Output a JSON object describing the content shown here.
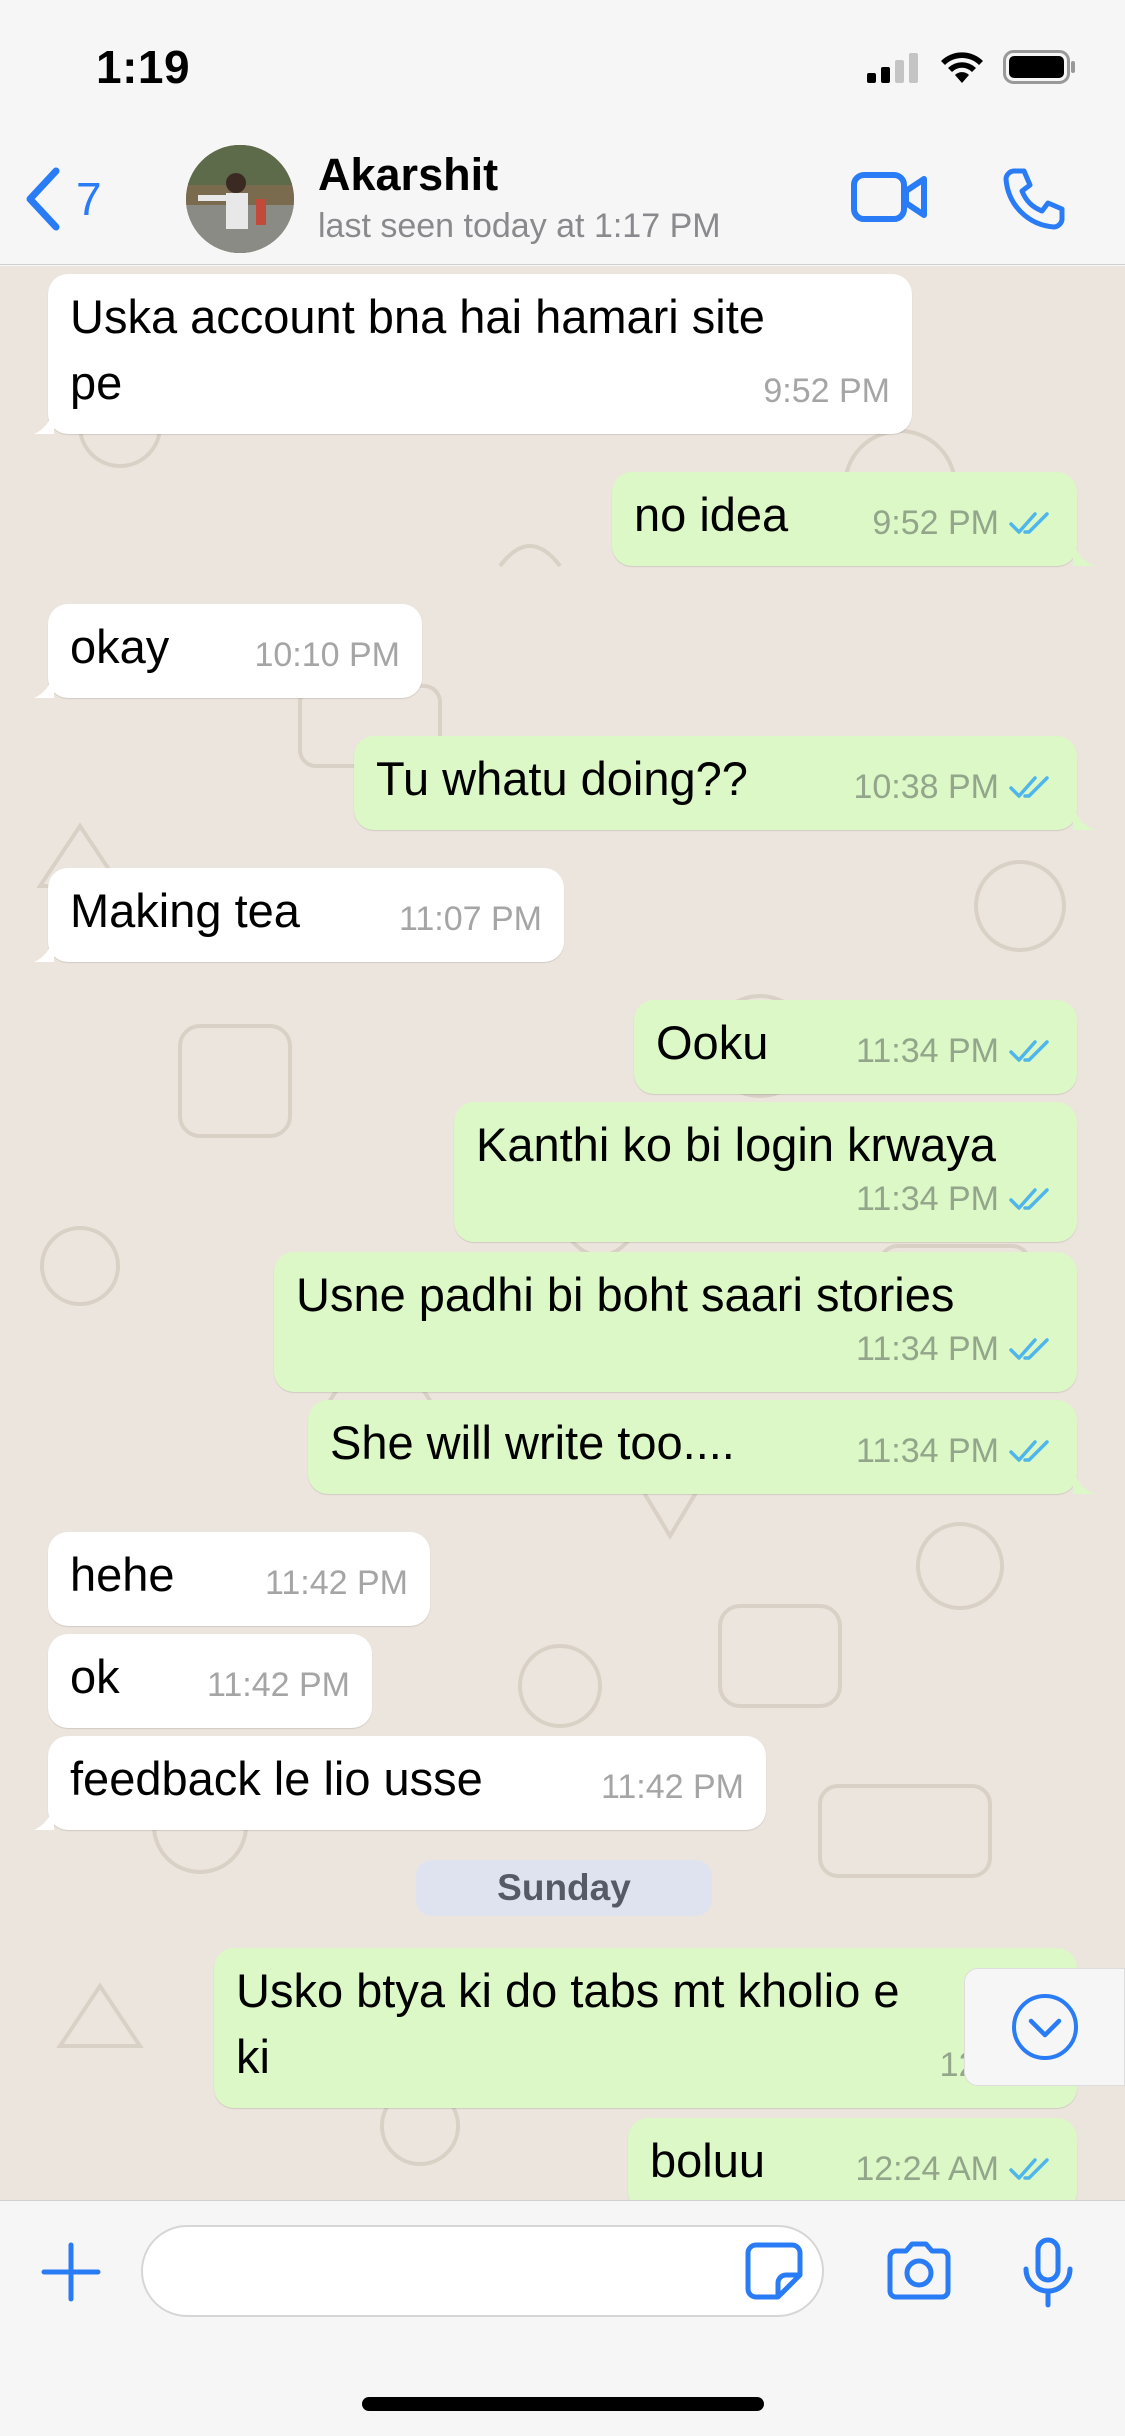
{
  "status_bar": {
    "time": "1:19"
  },
  "header": {
    "back_count": "7",
    "contact_name": "Akarshit",
    "contact_status": "last seen today at 1:17 PM"
  },
  "messages": [
    {
      "dir": "in",
      "text": "Uska account bna hai hamari site\npe",
      "time": "9:52 PM"
    },
    {
      "dir": "out",
      "text": "no idea",
      "time": "9:52 PM",
      "read": true
    },
    {
      "dir": "in",
      "text": "okay",
      "time": "10:10 PM"
    },
    {
      "dir": "out",
      "text": "Tu whatu doing??",
      "time": "10:38 PM",
      "read": true
    },
    {
      "dir": "in",
      "text": "Making tea",
      "time": "11:07 PM"
    },
    {
      "dir": "out",
      "text": "Ooku",
      "time": "11:34 PM",
      "read": true
    },
    {
      "dir": "out",
      "text": "Kanthi ko bi login krwaya",
      "time": "11:34 PM",
      "read": true
    },
    {
      "dir": "out",
      "text": "Usne padhi bi boht saari stories",
      "time": "11:34 PM",
      "read": true
    },
    {
      "dir": "out",
      "text": "She will write too....",
      "time": "11:34 PM",
      "read": true
    },
    {
      "dir": "in",
      "text": "hehe",
      "time": "11:42 PM"
    },
    {
      "dir": "in",
      "text": "ok",
      "time": "11:42 PM"
    },
    {
      "dir": "in",
      "text": "feedback le lio usse",
      "time": "11:42 PM"
    },
    {
      "dir": "out",
      "text": "Usko btya ki do tabs mt kholio e\nki",
      "time": "12:07 A",
      "read": true
    },
    {
      "dir": "out",
      "text": "boluu",
      "time": "12:24 AM",
      "read": true
    }
  ],
  "day_separator": "Sunday",
  "input": {
    "placeholder": "",
    "value": ""
  },
  "icons": {
    "back": "chevron-left-icon",
    "video": "video-camera-icon",
    "call": "phone-icon",
    "plus": "plus-icon",
    "sticker": "sticker-icon",
    "camera": "camera-icon",
    "mic": "microphone-icon",
    "scroll": "scroll-down-icon"
  },
  "colors": {
    "accent": "#2a7cf6",
    "incoming_bubble": "#ffffff",
    "outgoing_bubble": "#dcf8c6",
    "chat_background": "#ece5dd",
    "read_ticks": "#4fb6ec"
  }
}
